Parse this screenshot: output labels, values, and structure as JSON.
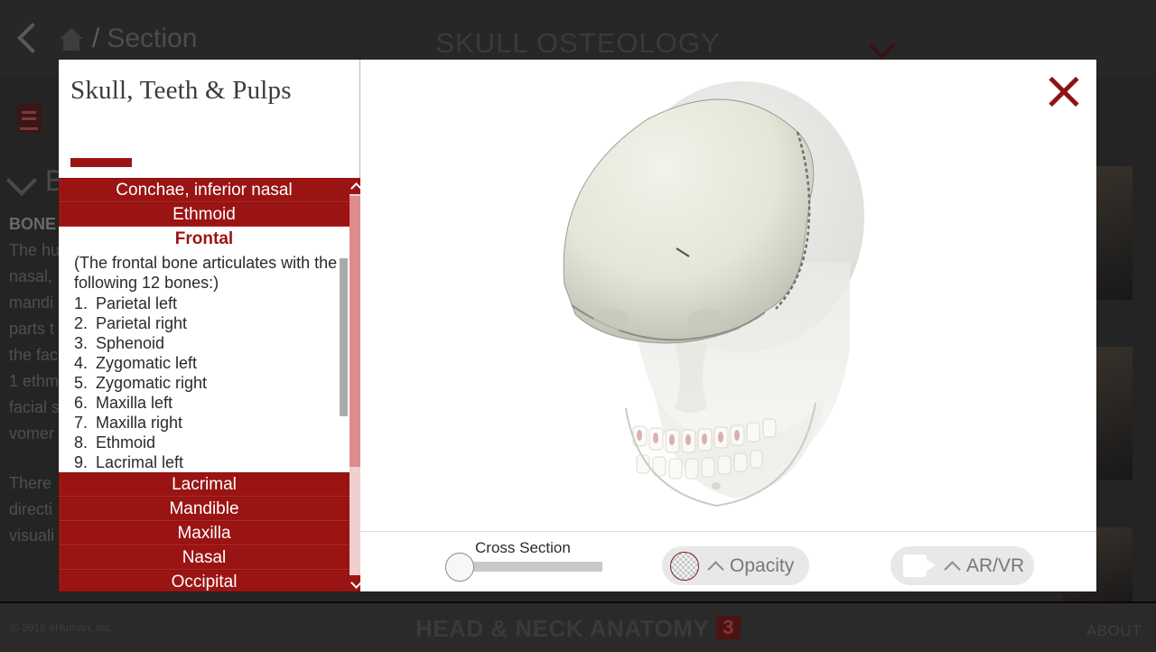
{
  "header": {
    "back_icon": "chevron-left-icon",
    "home_icon": "home-icon",
    "separator": "/",
    "breadcrumb": "Section",
    "title": "SKULL OSTEOLOGY",
    "caret_icon": "chevron-down-icon"
  },
  "background": {
    "book_icon": "book-icon",
    "section_caret_icon": "chevron-down-icon",
    "section_heading": "B",
    "body_bold": "BONE",
    "body_lines": [
      "The hu",
      "nasal,",
      "mandi",
      "parts t",
      "the fac",
      "1 ethm",
      "facial s",
      "vomer"
    ],
    "body_lines2": [
      "There",
      "directi",
      "visuali"
    ],
    "play_icon": "play-icon"
  },
  "modal": {
    "panel_title": "Skull, Teeth & Pulps",
    "close_icon": "close-icon",
    "scroll_up_icon": "chevron-up-icon",
    "scroll_down_icon": "chevron-down-icon",
    "bone_list": [
      {
        "label": "Conchae, inferior nasal",
        "selected": false
      },
      {
        "label": "Ethmoid",
        "selected": false
      },
      {
        "label": "Frontal",
        "selected": true
      },
      {
        "label": "Lacrimal",
        "selected": false
      },
      {
        "label": "Mandible",
        "selected": false
      },
      {
        "label": "Maxilla",
        "selected": false
      },
      {
        "label": "Nasal",
        "selected": false
      },
      {
        "label": "Occipital",
        "selected": false
      }
    ],
    "detail": {
      "lead": "(The frontal bone articulates with the following 12 bones:)",
      "items": [
        {
          "num": "1.",
          "label": "Parietal left"
        },
        {
          "num": "2.",
          "label": "Parietal right"
        },
        {
          "num": "3.",
          "label": "Sphenoid"
        },
        {
          "num": "4.",
          "label": "Zygomatic left"
        },
        {
          "num": "5.",
          "label": "Zygomatic right"
        },
        {
          "num": "6.",
          "label": "Maxilla left"
        },
        {
          "num": "7.",
          "label": "Maxilla right"
        },
        {
          "num": "8.",
          "label": "Ethmoid"
        },
        {
          "num": "9.",
          "label": "Lacrimal left"
        }
      ]
    }
  },
  "toolbar": {
    "cross_section_label": "Cross Section",
    "opacity_label": "Opacity",
    "opacity_icon": "opacity-checkerboard-icon",
    "arvr_label": "AR/VR",
    "arvr_icon": "video-camera-icon",
    "caret_icon": "chevron-up-icon"
  },
  "footer": {
    "copyright": "© 2018 eHuman, Inc.",
    "title": "HEAD & NECK ANATOMY",
    "badge": "3",
    "about": "ABOUT"
  },
  "colors": {
    "brand_red": "#9b1414",
    "close_red": "#8d1414",
    "scroll_track": "#f0cfcf",
    "scroll_thumb": "#de8b8b"
  }
}
